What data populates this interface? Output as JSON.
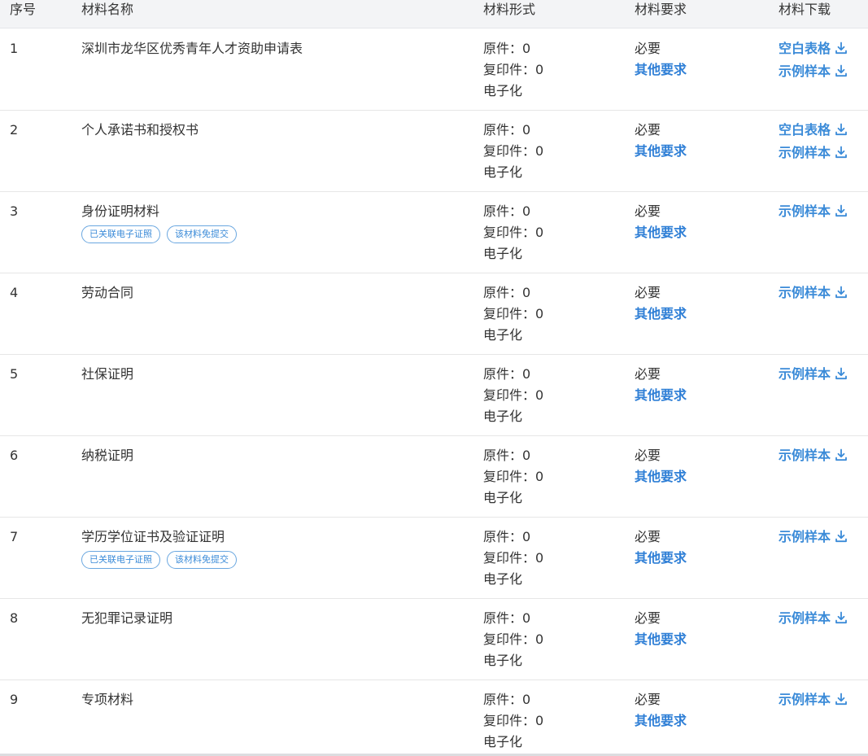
{
  "headers": {
    "index": "序号",
    "name": "材料名称",
    "form": "材料形式",
    "requirement": "材料要求",
    "download": "材料下载"
  },
  "rows": [
    {
      "index": "1",
      "name": "深圳市龙华区优秀青年人才资助申请表",
      "tags": [],
      "form": [
        "原件：0",
        "复印件：0",
        "电子化"
      ],
      "required": "必要",
      "other": "其他要求",
      "downloads": [
        "空白表格",
        "示例样本"
      ]
    },
    {
      "index": "2",
      "name": "个人承诺书和授权书",
      "tags": [],
      "form": [
        "原件：0",
        "复印件：0",
        "电子化"
      ],
      "required": "必要",
      "other": "其他要求",
      "downloads": [
        "空白表格",
        "示例样本"
      ]
    },
    {
      "index": "3",
      "name": "身份证明材料",
      "tags": [
        "已关联电子证照",
        "该材料免提交"
      ],
      "form": [
        "原件：0",
        "复印件：0",
        "电子化"
      ],
      "required": "必要",
      "other": "其他要求",
      "downloads": [
        "示例样本"
      ]
    },
    {
      "index": "4",
      "name": "劳动合同",
      "tags": [],
      "form": [
        "原件：0",
        "复印件：0",
        "电子化"
      ],
      "required": "必要",
      "other": "其他要求",
      "downloads": [
        "示例样本"
      ]
    },
    {
      "index": "5",
      "name": "社保证明",
      "tags": [],
      "form": [
        "原件：0",
        "复印件：0",
        "电子化"
      ],
      "required": "必要",
      "other": "其他要求",
      "downloads": [
        "示例样本"
      ]
    },
    {
      "index": "6",
      "name": "纳税证明",
      "tags": [],
      "form": [
        "原件：0",
        "复印件：0",
        "电子化"
      ],
      "required": "必要",
      "other": "其他要求",
      "downloads": [
        "示例样本"
      ]
    },
    {
      "index": "7",
      "name": "学历学位证书及验证证明",
      "tags": [
        "已关联电子证照",
        "该材料免提交"
      ],
      "form": [
        "原件：0",
        "复印件：0",
        "电子化"
      ],
      "required": "必要",
      "other": "其他要求",
      "downloads": [
        "示例样本"
      ]
    },
    {
      "index": "8",
      "name": "无犯罪记录证明",
      "tags": [],
      "form": [
        "原件：0",
        "复印件：0",
        "电子化"
      ],
      "required": "必要",
      "other": "其他要求",
      "downloads": [
        "示例样本"
      ]
    },
    {
      "index": "9",
      "name": "专项材料",
      "tags": [],
      "form": [
        "原件：0",
        "复印件：0",
        "电子化"
      ],
      "required": "必要",
      "other": "其他要求",
      "downloads": [
        "示例样本"
      ]
    }
  ],
  "icons": {
    "download": "download-icon"
  },
  "colors": {
    "link": "#2f7fd6",
    "download_link": "#3b8bd8",
    "tag_border": "#6aa7e0",
    "header_bg": "#f3f4f6"
  }
}
